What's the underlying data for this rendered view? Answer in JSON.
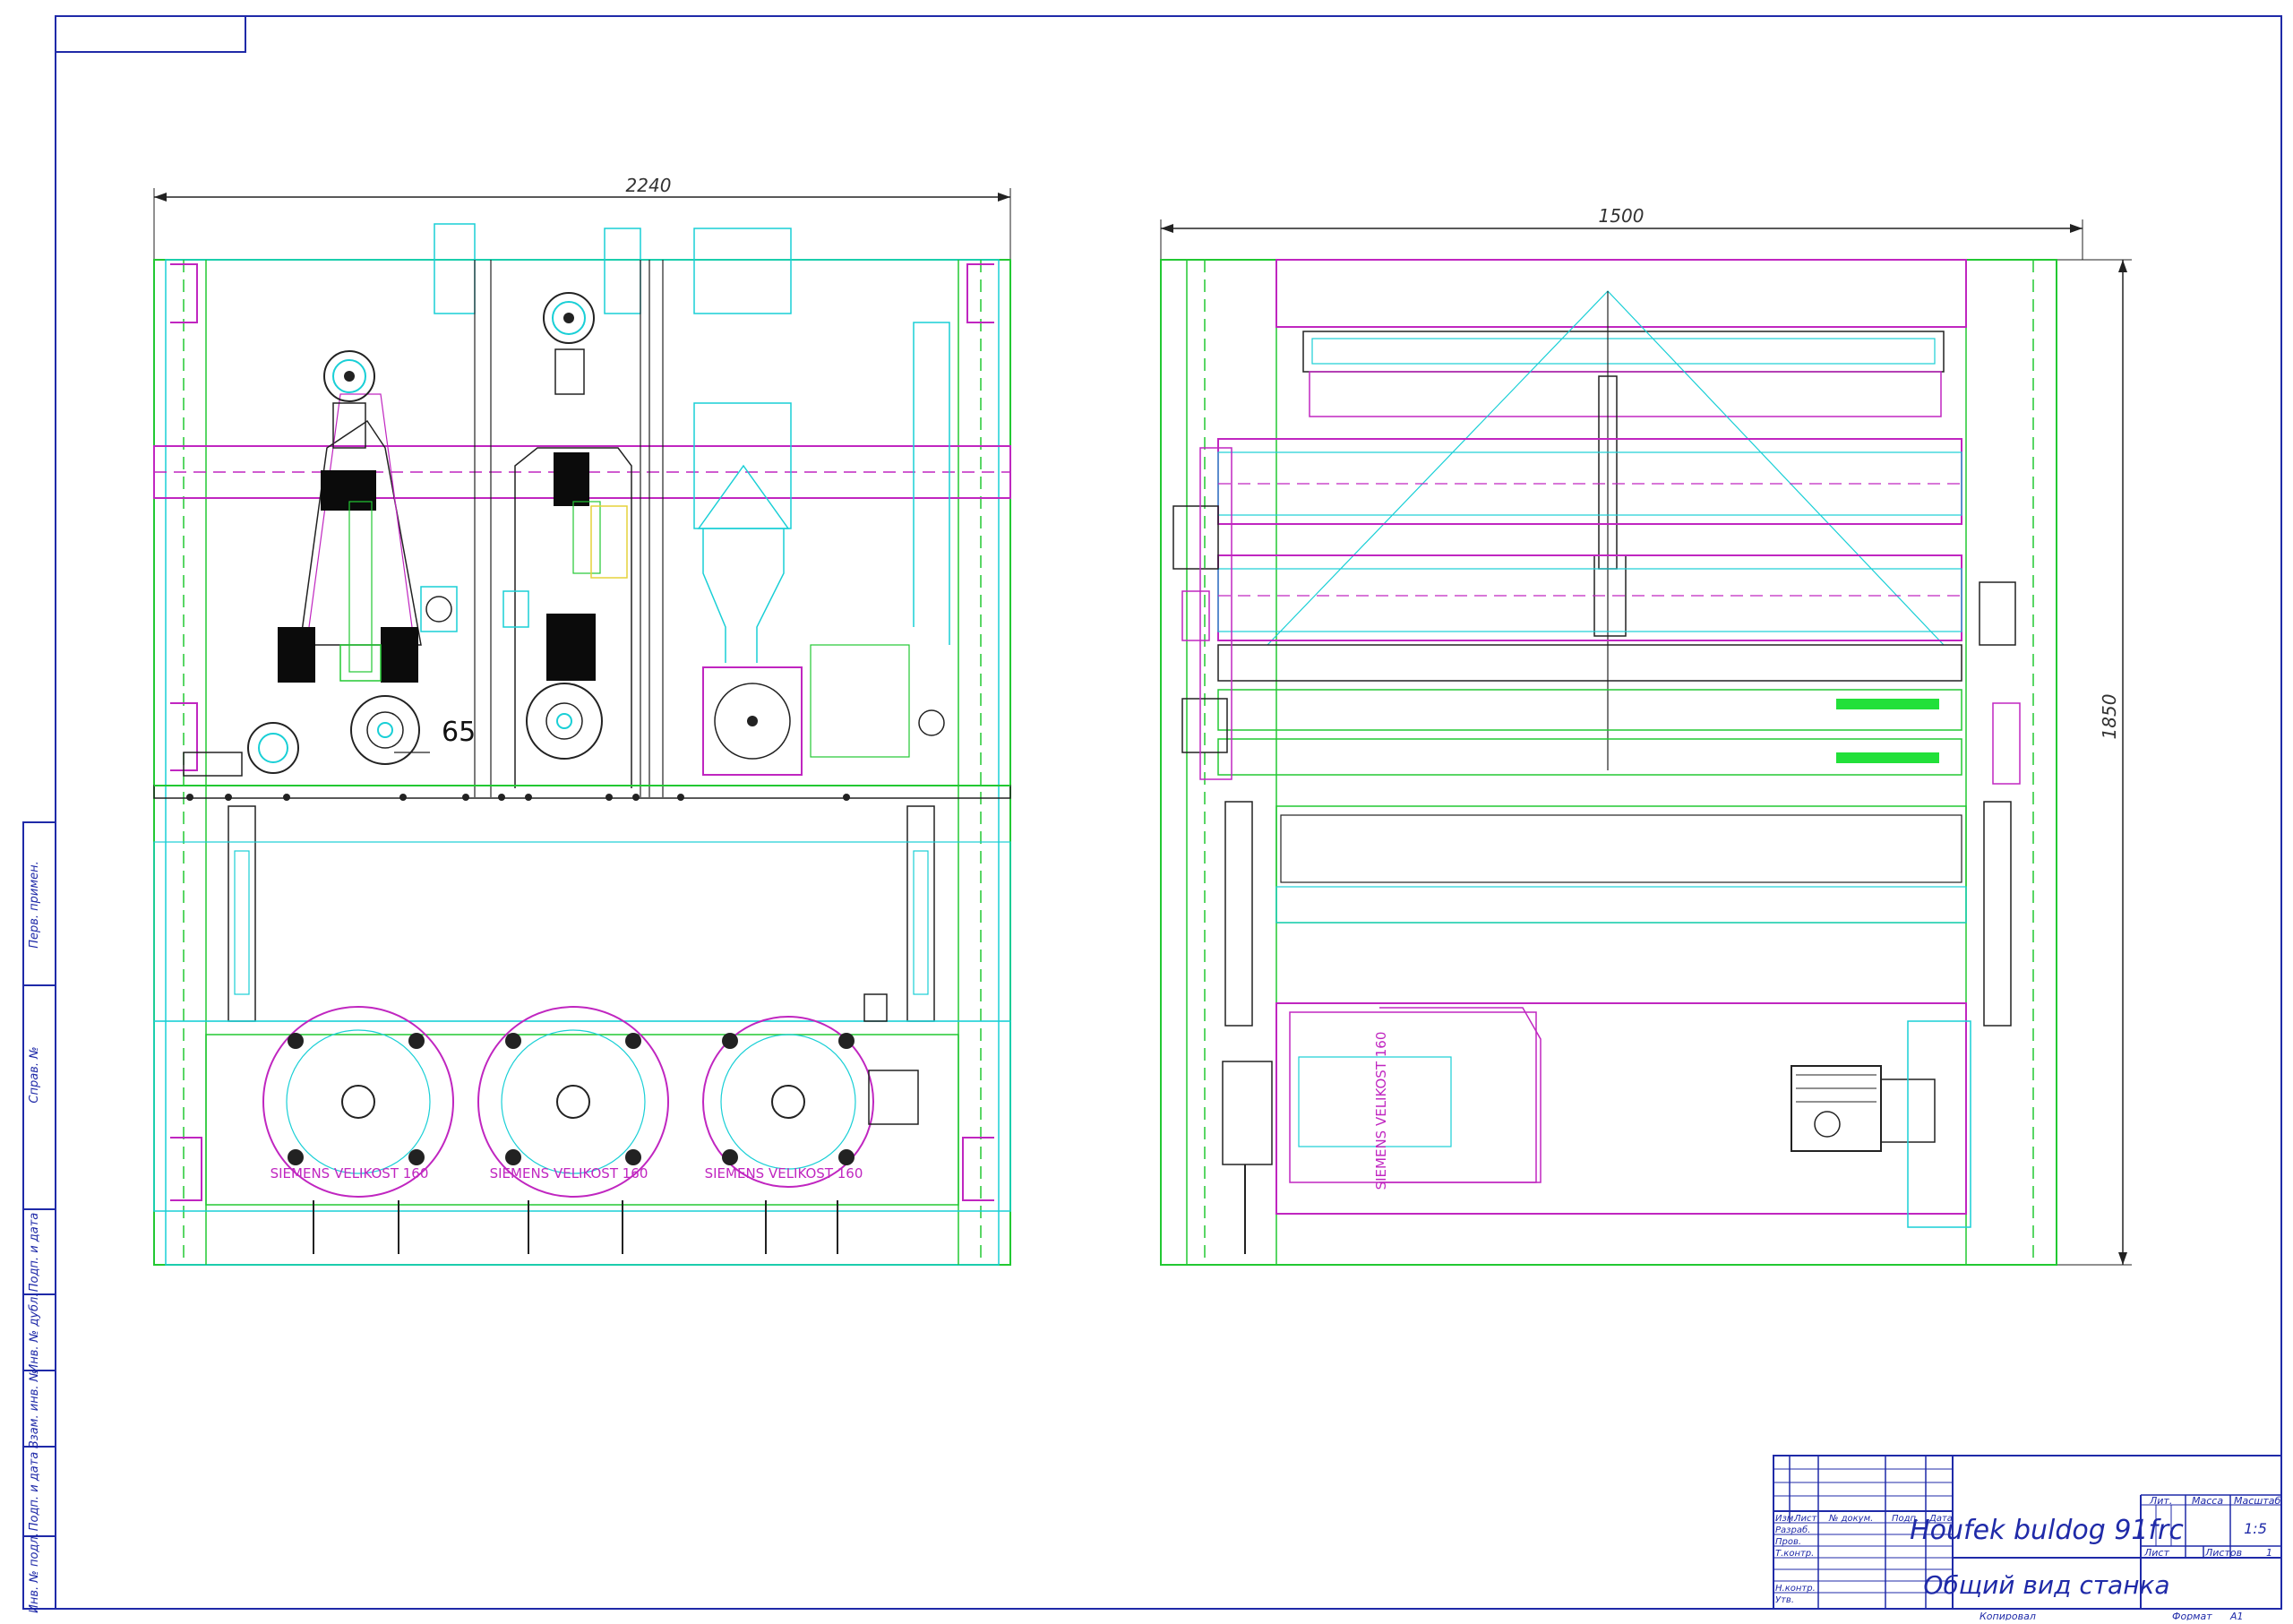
{
  "drawing": {
    "left_view": {
      "dim_width": "2240",
      "dim_detail": "65",
      "motor_labels": [
        "SIEMENS VELIKOST 160",
        "SIEMENS VELIKOST 160",
        "SIEMENS VELIKOST 160"
      ]
    },
    "right_view": {
      "dim_width": "1500",
      "dim_height": "1850",
      "motor_label": "SIEMENS VELIKOST 160"
    }
  },
  "side_strip": {
    "labels": [
      "Перв. примен.",
      "Справ. №",
      "Подп. и дата",
      "Инв. № дубл.",
      "Взам. инв. №",
      "Подп. и дата",
      "Инв. № подл."
    ]
  },
  "title_block": {
    "title": "Houfek buldog 91frc",
    "subtitle": "Общий вид станка",
    "col_headers": [
      "Изм.",
      "Лист",
      "№ докум.",
      "Подп.",
      "Дата"
    ],
    "roles": [
      "Разраб.",
      "Пров.",
      "Т.контр.",
      "Н.контр.",
      "Утв."
    ],
    "lit_label": "Лит.",
    "mass_label": "Масса",
    "scale_label": "Масштаб",
    "scale_value": "1:5",
    "sheet_label": "Лист",
    "sheets_label": "Листов",
    "sheets_value": "1",
    "copied_label": "Копировал",
    "format_label": "Формат",
    "format_value": "A1"
  },
  "colors": {
    "frame": "#1f2aa8",
    "magenta": "#c026c0",
    "cyan": "#19cfd6",
    "green": "#22c832",
    "yellow": "#e6d23a",
    "fill_green": "#22e03a"
  }
}
